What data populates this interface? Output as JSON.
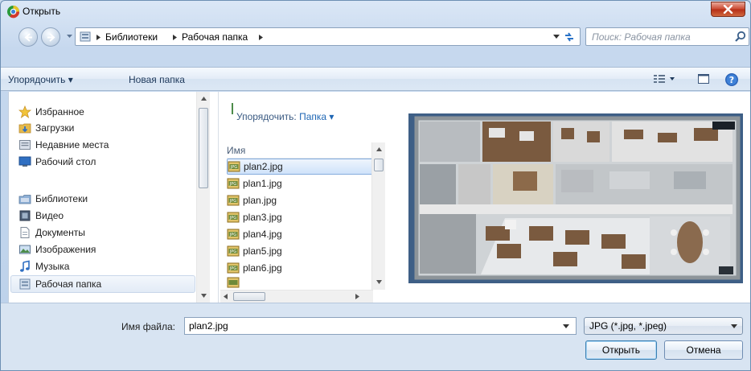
{
  "window": {
    "title": "Открыть",
    "icon": "app-chrome-icon",
    "close_icon": "close-icon"
  },
  "address": {
    "crumbs": [
      "Библиотеки",
      "Рабочая папка"
    ],
    "search_placeholder": "Поиск: Рабочая папка"
  },
  "toolbar": {
    "organize_label": "Упорядочить ▾",
    "new_folder_label": "Новая папка"
  },
  "navigation": {
    "favorites_header": "Избранное",
    "favorites": [
      "Загрузки",
      "Недавние места",
      "Рабочий стол"
    ],
    "libraries_header": "Библиотеки",
    "libraries": [
      "Видео",
      "Документы",
      "Изображения",
      "Музыка",
      "Рабочая папка"
    ],
    "selected": "Рабочая папка"
  },
  "file_list": {
    "arrange_label": "Упорядочить:",
    "arrange_value": "Папка ▾",
    "column_name": "Имя",
    "files": [
      "plan2.jpg",
      "plan1.jpg",
      "plan.jpg",
      "plan3.jpg",
      "plan4.jpg",
      "plan5.jpg",
      "plan6.jpg"
    ],
    "selected_file": "plan2.jpg"
  },
  "footer": {
    "filename_label": "Имя файла:",
    "filename_value": "plan2.jpg",
    "filetype_value": "JPG (*.jpg, *.jpeg)",
    "open_label": "Открыть",
    "cancel_label": "Отмена"
  },
  "colors": {
    "accent": "#3c7fb1",
    "selection": "#cfe3fa",
    "close_red": "#c9462f"
  }
}
